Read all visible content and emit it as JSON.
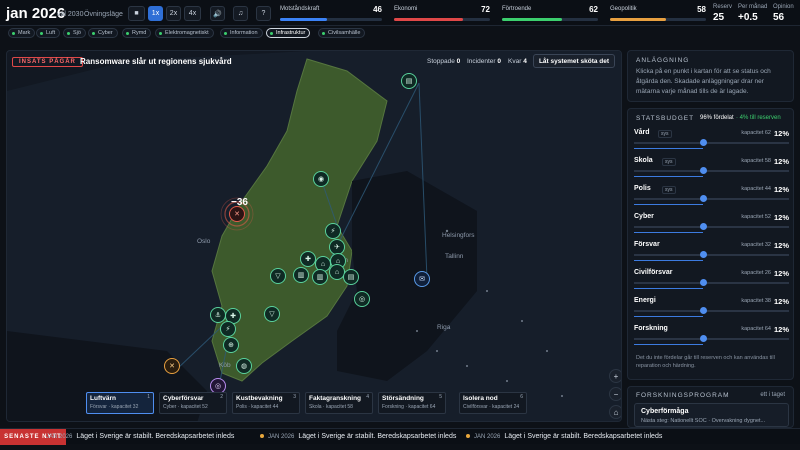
{
  "header": {
    "date": "jan 2026",
    "goal": "val 2030",
    "mode": "Övningsläge",
    "controls": [
      "■",
      "1x",
      "2x",
      "4x",
      "🔊",
      "♫",
      "?"
    ],
    "meters": [
      {
        "label": "Motståndskraft",
        "value": "46",
        "fill": 0.46,
        "color": "#3b82f6"
      },
      {
        "label": "Ekonomi",
        "value": "72",
        "fill": 0.72,
        "color": "#e04848"
      },
      {
        "label": "Förtroende",
        "value": "62",
        "fill": 0.62,
        "color": "#3ccf6e"
      },
      {
        "label": "Geopolitik",
        "value": "58",
        "fill": 0.58,
        "color": "#e8a040"
      }
    ],
    "stats": [
      {
        "label": "Reserv",
        "value": "25"
      },
      {
        "label": "Per månad",
        "value": "+0.5"
      },
      {
        "label": "Opinion",
        "value": "56"
      }
    ]
  },
  "tags": [
    {
      "label": "Mark"
    },
    {
      "label": "Luft"
    },
    {
      "label": "Sjö"
    },
    {
      "label": "Cyber"
    },
    {
      "label": "Rymd"
    },
    {
      "label": "Elektromagnetiskt"
    },
    {
      "label": "Information"
    },
    {
      "label": "Infrastruktur"
    },
    {
      "label": "Civilsamhälle"
    }
  ],
  "map": {
    "alarm": "INSATS PÅGÅR",
    "headline": "Ransomware slår ut regionens sjukvård",
    "stopped_label": "Stoppade",
    "stopped": "0",
    "incidents_label": "Incidenter",
    "incidents": "0",
    "queue_label": "Kvar",
    "queue": "4",
    "run_button": "Låt systemet sköta det",
    "event_value": "−36",
    "cities": [
      "Oslo",
      "Helsingfors",
      "Tallinn",
      "Riga",
      "Köb",
      "lm"
    ],
    "controls": [
      "+",
      "−",
      "⌂"
    ]
  },
  "cards": [
    {
      "title": "Luftvärn",
      "sub": "Försvar · kapacitet 32",
      "n": "1"
    },
    {
      "title": "Cyberförsvar",
      "sub": "Cyber · kapacitet 52",
      "n": "2"
    },
    {
      "title": "Kustbevakning",
      "sub": "Polis · kapacitet 44",
      "n": "3"
    },
    {
      "title": "Faktagranskning",
      "sub": "Skola · kapacitet 58",
      "n": "4"
    },
    {
      "title": "Störsändning",
      "sub": "Forskning · kapacitet 64",
      "n": "5"
    },
    {
      "title": "Isolera nod",
      "sub": "Civilförsvar · kapacitet 24",
      "n": "6"
    }
  ],
  "panel_facility": {
    "title": "ANLÄGGNING",
    "text": "Klicka på en punkt i kartan för att se status och åtgärda den. Skadade anläggningar drar ner mätarna varje månad tills de är lagade."
  },
  "panel_budget": {
    "title": "STATSBUDGET",
    "summary": "96% fördelat",
    "reserve": "· 4% till reserven",
    "rows": [
      {
        "name": "Vård",
        "sys": "sys",
        "cap": "kapacitet 62",
        "pct": "12%",
        "level": 0.12
      },
      {
        "name": "Skola",
        "sys": "sys",
        "cap": "kapacitet 58",
        "pct": "12%",
        "level": 0.12
      },
      {
        "name": "Polis",
        "sys": "sys",
        "cap": "kapacitet 44",
        "pct": "12%",
        "level": 0.12
      },
      {
        "name": "Cyber",
        "sys": "",
        "cap": "kapacitet 52",
        "pct": "12%",
        "level": 0.12
      },
      {
        "name": "Försvar",
        "sys": "",
        "cap": "kapacitet 32",
        "pct": "12%",
        "level": 0.12
      },
      {
        "name": "Civilförsvar",
        "sys": "",
        "cap": "kapacitet 26",
        "pct": "12%",
        "level": 0.12
      },
      {
        "name": "Energi",
        "sys": "",
        "cap": "kapacitet 38",
        "pct": "12%",
        "level": 0.12
      },
      {
        "name": "Forskning",
        "sys": "",
        "cap": "kapacitet 64",
        "pct": "12%",
        "level": 0.12
      }
    ],
    "footer": "Det du inte fördelar går till reserven och kan användas till reparation och härdning."
  },
  "panel_research": {
    "title": "FORSKNINGSPROGRAM",
    "right": "ett i taget",
    "item": "Cyberförmåga",
    "item_sub": "Nästa steg: Nationellt SOC · Övervakning dygnet..."
  },
  "ticker": {
    "badge": "SENASTE NYTT",
    "items": [
      {
        "date": "JAN 2026",
        "text": "Läget i Sverige är stabilt. Beredskapsarbetet inleds"
      },
      {
        "date": "JAN 2026",
        "text": "Läget i Sverige är stabilt. Beredskapsarbetet inleds"
      },
      {
        "date": "JAN 2026",
        "text": "Läget i Sverige är stabilt. Beredskapsarbetet inleds"
      }
    ]
  }
}
